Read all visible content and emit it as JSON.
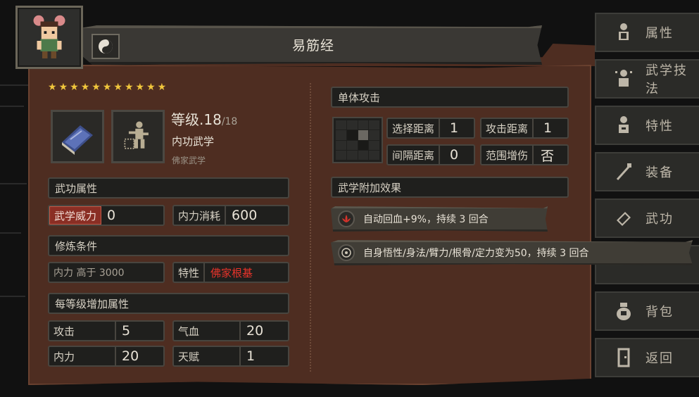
{
  "title": "易筋经",
  "stars_count": 11,
  "level": {
    "label": "等级.",
    "current": "18",
    "max": "/18"
  },
  "skill_kind": "内功武学",
  "skill_school": "佛家武学",
  "sections": {
    "attrs": "武功属性",
    "requirements": "修炼条件",
    "per_level": "每等级增加属性",
    "single_attack": "单体攻击",
    "extra_effects": "武学附加效果"
  },
  "attrs": {
    "power_label": "武学威力",
    "power_value": "0",
    "cost_label": "内力消耗",
    "cost_value": "600"
  },
  "requirements": {
    "req1": "内力 高于 3000",
    "req2_label": "特性",
    "req2_value": "佛家根基"
  },
  "per_level": {
    "atk_label": "攻击",
    "atk_value": "5",
    "hp_label": "气血",
    "hp_value": "20",
    "mp_label": "内力",
    "mp_value": "20",
    "talent_label": "天赋",
    "talent_value": "1"
  },
  "attack": {
    "select_range_label": "选择距离",
    "select_range_value": "1",
    "attack_range_label": "攻击距离",
    "attack_range_value": "1",
    "interval_label": "间隔距离",
    "interval_value": "0",
    "area_damage_label": "范围增伤",
    "area_damage_value": "否"
  },
  "effects": [
    {
      "icon": "lotus-icon",
      "text": "自动回血+9%，持续 3 回合"
    },
    {
      "icon": "target-icon",
      "text": "自身悟性/身法/臂力/根骨/定力变为50，持续 3 回合"
    }
  ],
  "sidebar": [
    {
      "icon": "person-icon",
      "label": "属性"
    },
    {
      "icon": "skill-person-icon",
      "label": "武学技法"
    },
    {
      "icon": "trait-person-icon",
      "label": "特性"
    },
    {
      "icon": "sword-icon",
      "label": "装备"
    },
    {
      "icon": "book-icon",
      "label": "武功"
    },
    {
      "icon": "bag-icon",
      "label": "背包"
    },
    {
      "icon": "door-icon",
      "label": "返回"
    }
  ],
  "colors": {
    "panel": "#4e2d21",
    "star": "#f0c63c",
    "highlight_red": "#e8332a",
    "highlight_yellow": "#e9c43a"
  }
}
